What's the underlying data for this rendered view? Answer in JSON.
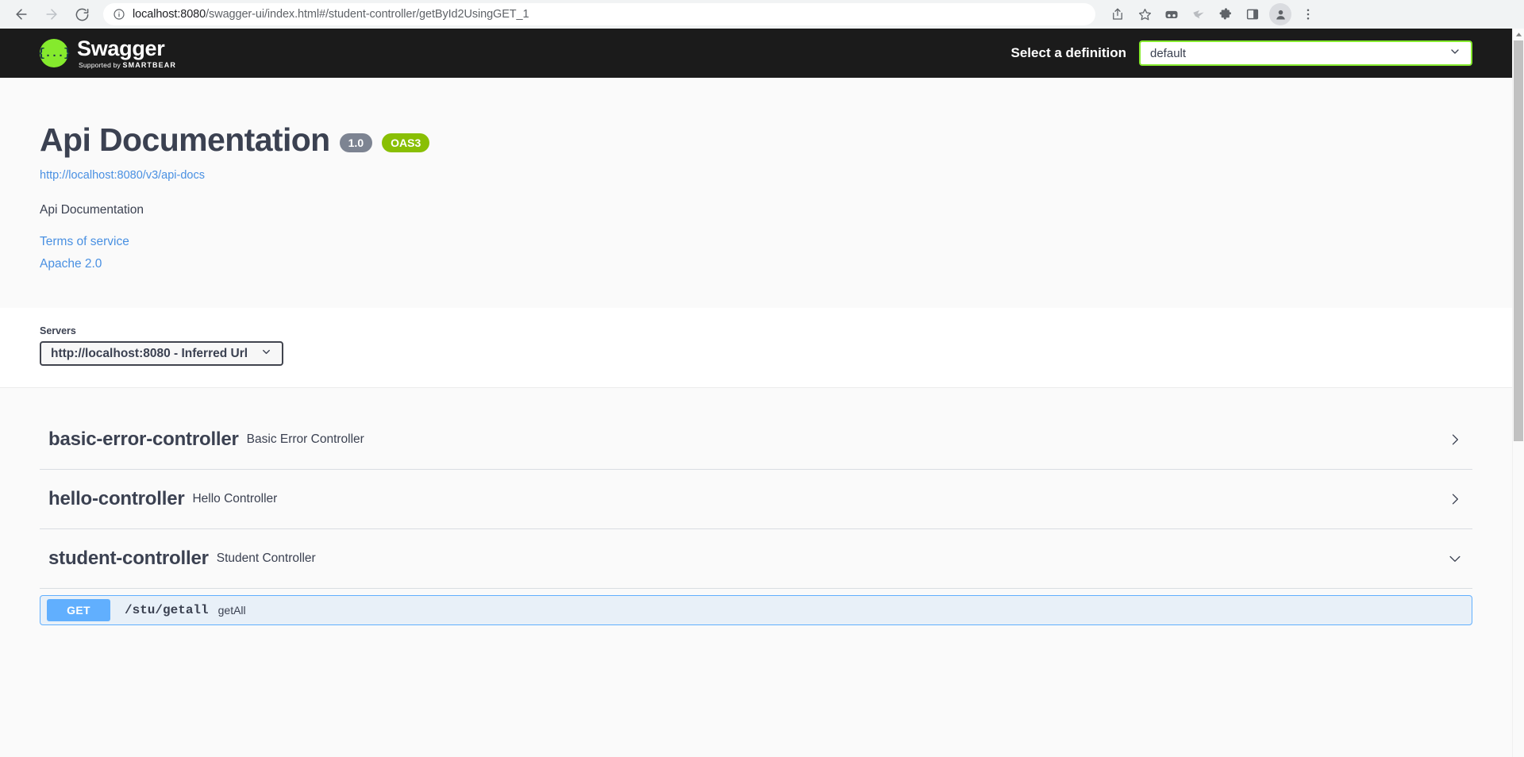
{
  "browser": {
    "back_icon": "arrow-left-icon",
    "forward_icon": "arrow-right-icon",
    "reload_icon": "reload-icon",
    "site_info_icon": "info-circle-icon",
    "url_host": "localhost:8080",
    "url_path": "/swagger-ui/index.html#/student-controller/getById2UsingGET_1",
    "toolbar_icons": [
      "share-icon",
      "bookmark-star-icon",
      "reading-list-icon",
      "kiwi-extension-icon",
      "extensions-puzzle-icon",
      "side-panel-icon",
      "profile-avatar-icon",
      "three-dot-menu-icon"
    ]
  },
  "topbar": {
    "logo_glyph": "{...}",
    "logo_title": "Swagger",
    "logo_supported_by": "Supported by",
    "logo_brand": "SMARTBEAR",
    "definition_label": "Select a definition",
    "definition_value": "default",
    "definition_chevron": "chevron-down-icon",
    "accent_green": "#85ea2d",
    "background": "#1b1b1b"
  },
  "info": {
    "title": "Api Documentation",
    "version_badge": "1.0",
    "oas_badge": "OAS3",
    "docs_url": "http://localhost:8080/v3/api-docs",
    "description": "Api Documentation",
    "terms_link": "Terms of service",
    "license_link": "Apache 2.0",
    "link_color": "#4990e2",
    "oas_badge_color": "#89bf04",
    "version_badge_color": "#7d8492"
  },
  "servers": {
    "label": "Servers",
    "selected": "http://localhost:8080 - Inferred Url",
    "chevron": "chevron-down-icon"
  },
  "tags": [
    {
      "name": "basic-error-controller",
      "description": "Basic Error Controller",
      "expanded": false,
      "arrow_icon": "chevron-right-icon",
      "operations": []
    },
    {
      "name": "hello-controller",
      "description": "Hello Controller",
      "expanded": false,
      "arrow_icon": "chevron-right-icon",
      "operations": []
    },
    {
      "name": "student-controller",
      "description": "Student Controller",
      "expanded": true,
      "arrow_icon": "chevron-down-icon",
      "operations": [
        {
          "method": "GET",
          "path": "/stu/getall",
          "summary": "getAll",
          "method_color": "#61affe"
        }
      ]
    }
  ],
  "scrollbar": {
    "up_arrow_icon": "triangle-up-icon",
    "down_arrow_icon": "triangle-down-icon"
  }
}
